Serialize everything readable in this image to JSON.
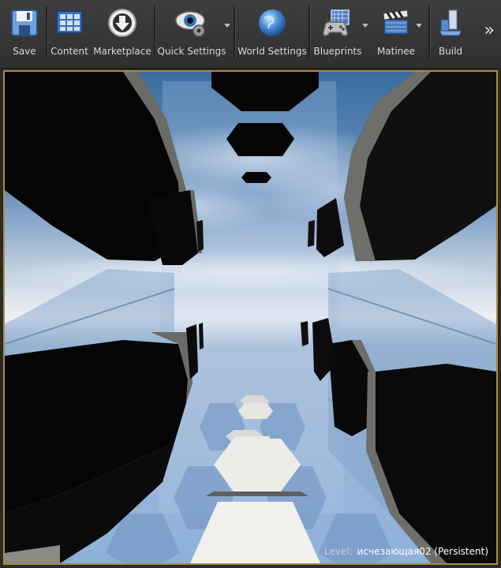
{
  "toolbar": {
    "save": "Save",
    "content": "Content",
    "marketplace": "Marketplace",
    "quick_settings": "Quick Settings",
    "world_settings": "World Settings",
    "blueprints": "Blueprints",
    "matinee": "Matinee",
    "build": "Build",
    "more_glyph": "»"
  },
  "viewport": {
    "level_label": "Level:",
    "level_name": "исчезающая02 (Persistent)"
  },
  "colors": {
    "accent_border": "#a88d3a",
    "toolbar_bg": "#333333",
    "sky_top": "#3d6fa3",
    "floor_blue": "#8fb0d8"
  }
}
